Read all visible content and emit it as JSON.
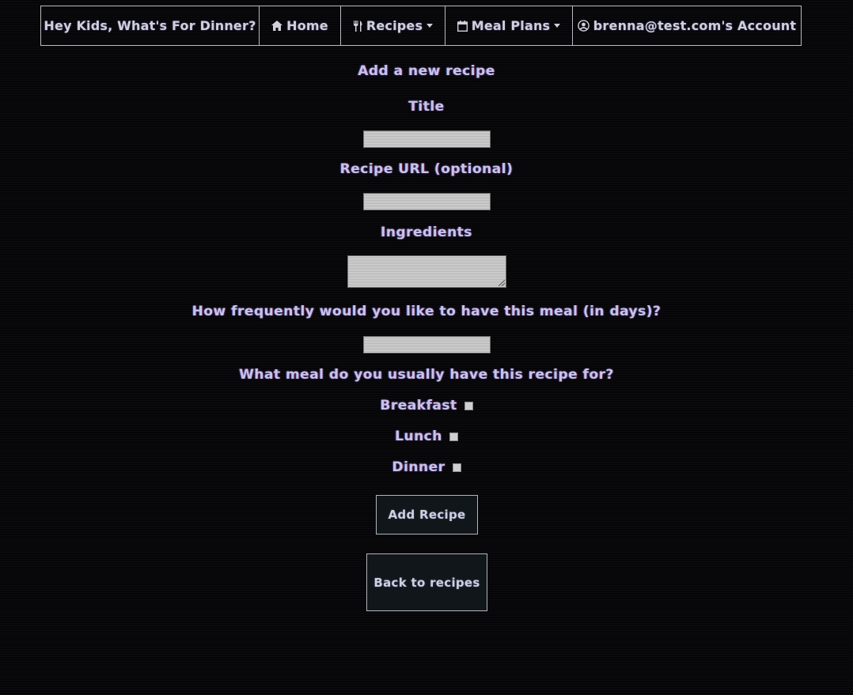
{
  "nav": {
    "brand": "Hey Kids, What's For Dinner?",
    "items": [
      {
        "label": "Home",
        "icon": "home-icon"
      },
      {
        "label": "Recipes",
        "icon": "utensils-icon",
        "dropdown": true
      },
      {
        "label": "Meal Plans",
        "icon": "calendar-icon",
        "dropdown": true
      },
      {
        "label": "brenna@test.com's Account",
        "icon": "user-circle-icon"
      }
    ]
  },
  "form": {
    "heading": "Add a new recipe",
    "title_label": "Title",
    "title_value": "",
    "url_label": "Recipe URL (optional)",
    "url_value": "",
    "ingredients_label": "Ingredients",
    "ingredients_value": "",
    "frequency_label": "How frequently would you like to have this meal (in days)?",
    "frequency_value": "",
    "meal_label": "What meal do you usually have this recipe for?",
    "meals": [
      {
        "label": "Breakfast",
        "checked": false
      },
      {
        "label": "Lunch",
        "checked": false
      },
      {
        "label": "Dinner",
        "checked": false
      }
    ],
    "submit_label": "Add Recipe",
    "back_label": "Back to recipes"
  },
  "colors": {
    "background": "#060507",
    "label_text": "#c8c3ea",
    "border": "#b9b9bf",
    "button_bg": "#101619"
  }
}
